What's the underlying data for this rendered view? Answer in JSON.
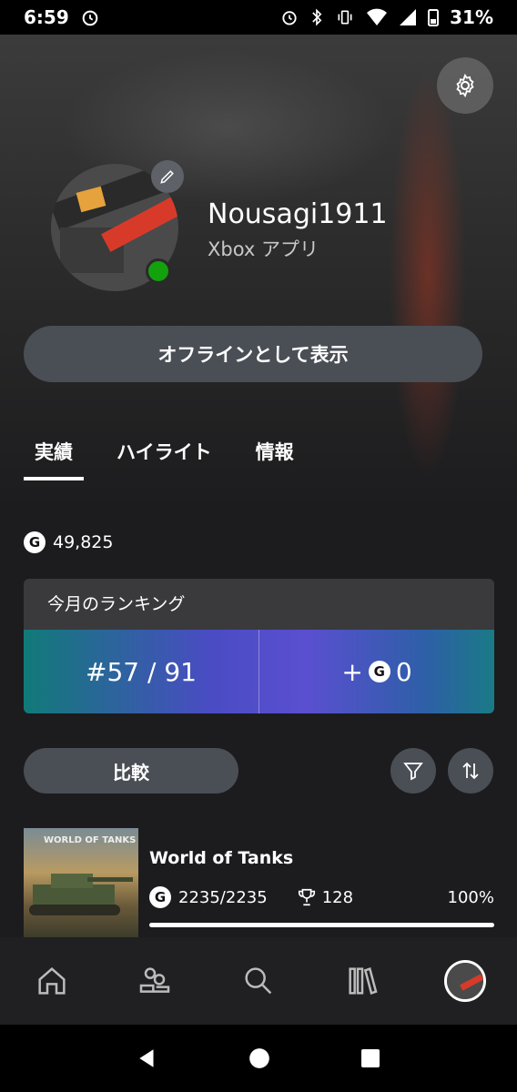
{
  "status_bar": {
    "time": "6:59",
    "battery": "31%"
  },
  "profile": {
    "gamertag": "Nousagi1911",
    "subtitle": "Xbox アプリ",
    "offline_button": "オフラインとして表示"
  },
  "tabs": [
    {
      "label": "実績",
      "active": true
    },
    {
      "label": "ハイライト",
      "active": false
    },
    {
      "label": "情報",
      "active": false
    }
  ],
  "gamerscore": {
    "badge": "G",
    "value": "49,825"
  },
  "ranking": {
    "title": "今月のランキング",
    "rank": "#57 / 91",
    "gain_prefix": "+",
    "gain_badge": "G",
    "gain_value": "0"
  },
  "controls": {
    "compare_label": "比較"
  },
  "games": [
    {
      "title": "World of Tanks",
      "thumb_text": "WORLD OF TANKS",
      "score": "2235/2235",
      "trophies": "128",
      "percent": "100%",
      "progress": 1.0
    }
  ],
  "colors": {
    "accent": "#13a10e",
    "button_bg": "#4a4e55"
  }
}
